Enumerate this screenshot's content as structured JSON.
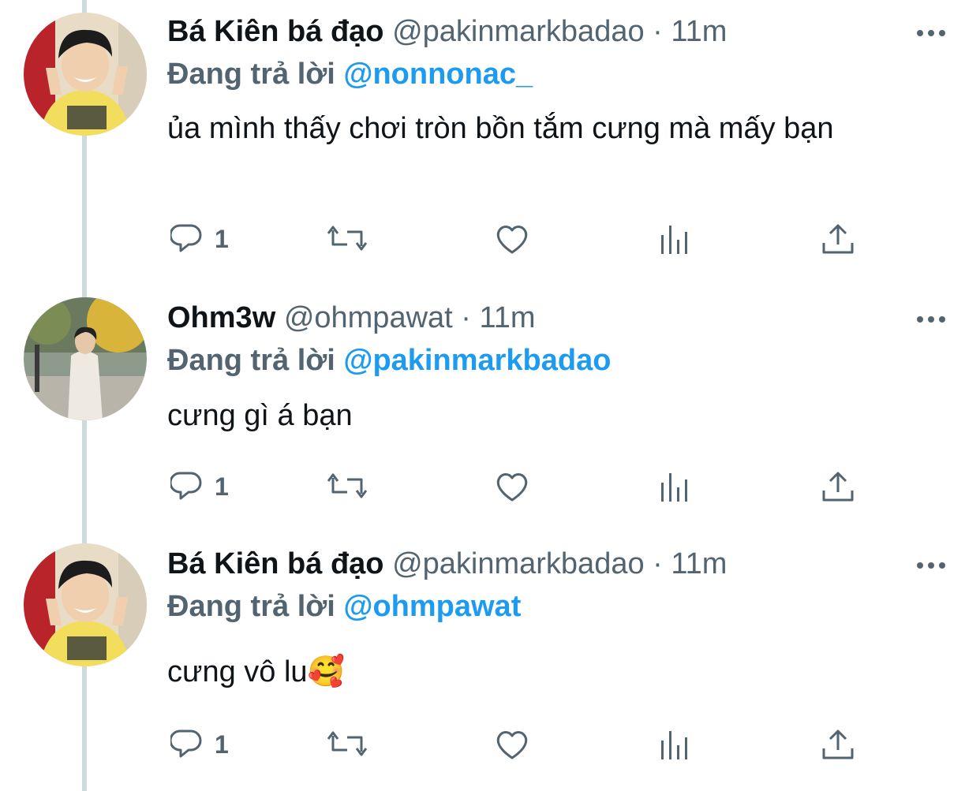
{
  "colors": {
    "link": "#1d9bf0",
    "secondary_text": "#536471",
    "primary_text": "#0f1419",
    "thread_line": "#cfd9de"
  },
  "tweets": [
    {
      "display_name": "Bá Kiên bá đạo",
      "handle_time": "@pakinmarkbadao · 11m",
      "reply_prefix": "Đang trả lời",
      "reply_to": "@nonnonac_",
      "text": "ủa mình thấy chơi tròn bồn tắm cưng mà mấy bạn",
      "reply_count": "1",
      "avatar_icon": "profile-photo-peace-sign"
    },
    {
      "display_name": "Ohm3w",
      "handle_time": "@ohmpawat · 11m",
      "reply_prefix": "Đang trả lời",
      "reply_to": "@pakinmarkbadao",
      "text": "cưng gì á bạn",
      "reply_count": "1",
      "avatar_icon": "profile-photo-street-autumn"
    },
    {
      "display_name": "Bá Kiên bá đạo",
      "handle_time": "@pakinmarkbadao · 11m",
      "reply_prefix": "Đang trả lời",
      "reply_to": "@ohmpawat",
      "text": "cưng vô lu🥰",
      "reply_count": "1",
      "avatar_icon": "profile-photo-peace-sign"
    }
  ],
  "action_icons": [
    "reply-icon",
    "retweet-icon",
    "like-icon",
    "analytics-icon",
    "share-icon",
    "more-icon"
  ]
}
